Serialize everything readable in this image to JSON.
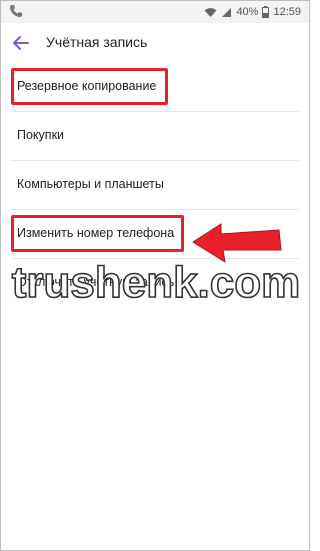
{
  "status_bar": {
    "battery_percent": "40%",
    "time": "12:59"
  },
  "app_bar": {
    "title": "Учётная запись"
  },
  "list": {
    "items": [
      {
        "label": "Резервное копирование"
      },
      {
        "label": "Покупки"
      },
      {
        "label": "Компьютеры и планшеты"
      },
      {
        "label": "Изменить номер телефона"
      },
      {
        "label": "Отключить учётную запись"
      }
    ]
  },
  "watermark": {
    "text": "trushenk.com"
  },
  "colors": {
    "accent": "#7b5cc4",
    "highlight": "#e8202a"
  }
}
